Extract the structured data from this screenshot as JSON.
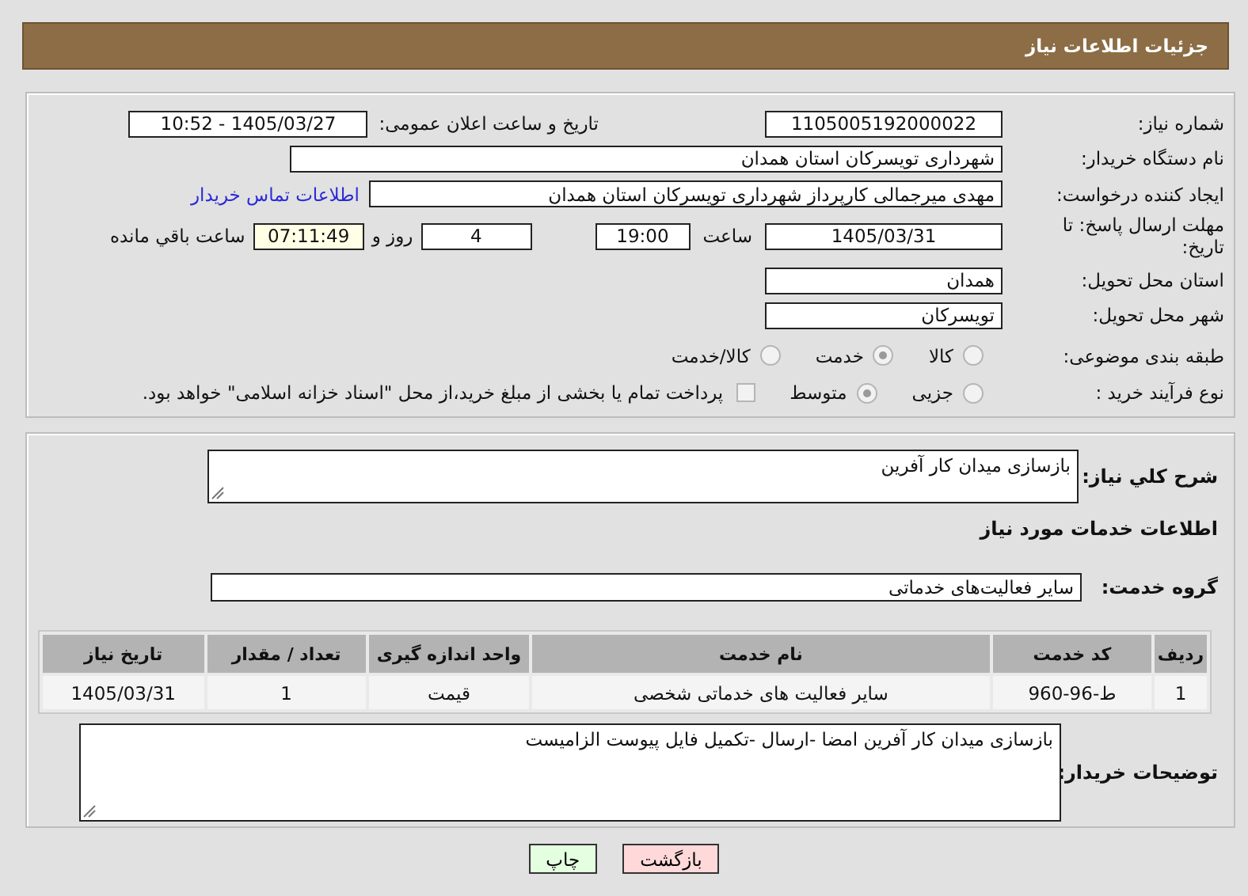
{
  "header": {
    "title": "جزئیات اطلاعات نیاز"
  },
  "details": {
    "need_number": {
      "label": "شماره نیاز:",
      "value": "1105005192000022"
    },
    "announce": {
      "label": "تاریخ و ساعت اعلان عمومی:",
      "value": "1405/03/27 - 10:52"
    },
    "buyer_org": {
      "label": "نام دستگاه خریدار:",
      "value": "شهرداری تویسرکان استان همدان"
    },
    "creator": {
      "label": "ایجاد کننده درخواست:",
      "value": "مهدی میرجمالی کارپرداز شهرداری تویسرکان استان همدان",
      "link": "اطلاعات تماس خریدار"
    },
    "deadline": {
      "label": "مهلت ارسال پاسخ: تا تاریخ:",
      "date": "1405/03/31",
      "time_label": "ساعت",
      "time": "19:00",
      "days": "4",
      "days_label": "روز و",
      "remaining": "07:11:49",
      "remaining_label": "ساعت باقي مانده"
    },
    "province": {
      "label": "استان محل تحویل:",
      "value": "همدان"
    },
    "city": {
      "label": "شهر محل تحویل:",
      "value": "تویسرکان"
    },
    "category": {
      "label": "طبقه بندی موضوعی:",
      "options": [
        {
          "label": "کالا",
          "selected": false
        },
        {
          "label": "خدمت",
          "selected": true
        },
        {
          "label": "کالا/خدمت",
          "selected": false
        }
      ]
    },
    "purchase_type": {
      "label": "نوع فرآیند خرید :",
      "options": [
        {
          "label": "جزیی",
          "selected": false
        },
        {
          "label": "متوسط",
          "selected": true
        }
      ],
      "treasury": {
        "checked": false,
        "text": "پرداخت تمام یا بخشی از مبلغ خرید،از محل \"اسناد خزانه اسلامی\" خواهد بود."
      }
    }
  },
  "services": {
    "description": {
      "label": "شرح کلي نیاز:",
      "value": "بازسازی میدان کار آفرین"
    },
    "heading": "اطلاعات خدمات مورد نیاز",
    "group": {
      "label": "گروه خدمت:",
      "value": "سایر فعالیت‌های خدماتی"
    },
    "table": {
      "columns": [
        "ردیف",
        "کد خدمت",
        "نام خدمت",
        "واحد اندازه گیری",
        "تعداد / مقدار",
        "تاریخ نیاز"
      ],
      "rows": [
        [
          "1",
          "ط-96-960",
          "سایر فعالیت های خدماتی شخصی",
          "قیمت",
          "1",
          "1405/03/31"
        ]
      ]
    },
    "buyer_notes": {
      "label": "توضیحات خریدار:",
      "value": "بازسازی میدان کار آفرین امضا -ارسال -تکمیل فایل پیوست الزامیست"
    }
  },
  "buttons": [
    {
      "label": "بازگشت",
      "kind": "back"
    },
    {
      "label": "چاپ",
      "kind": "print"
    }
  ]
}
